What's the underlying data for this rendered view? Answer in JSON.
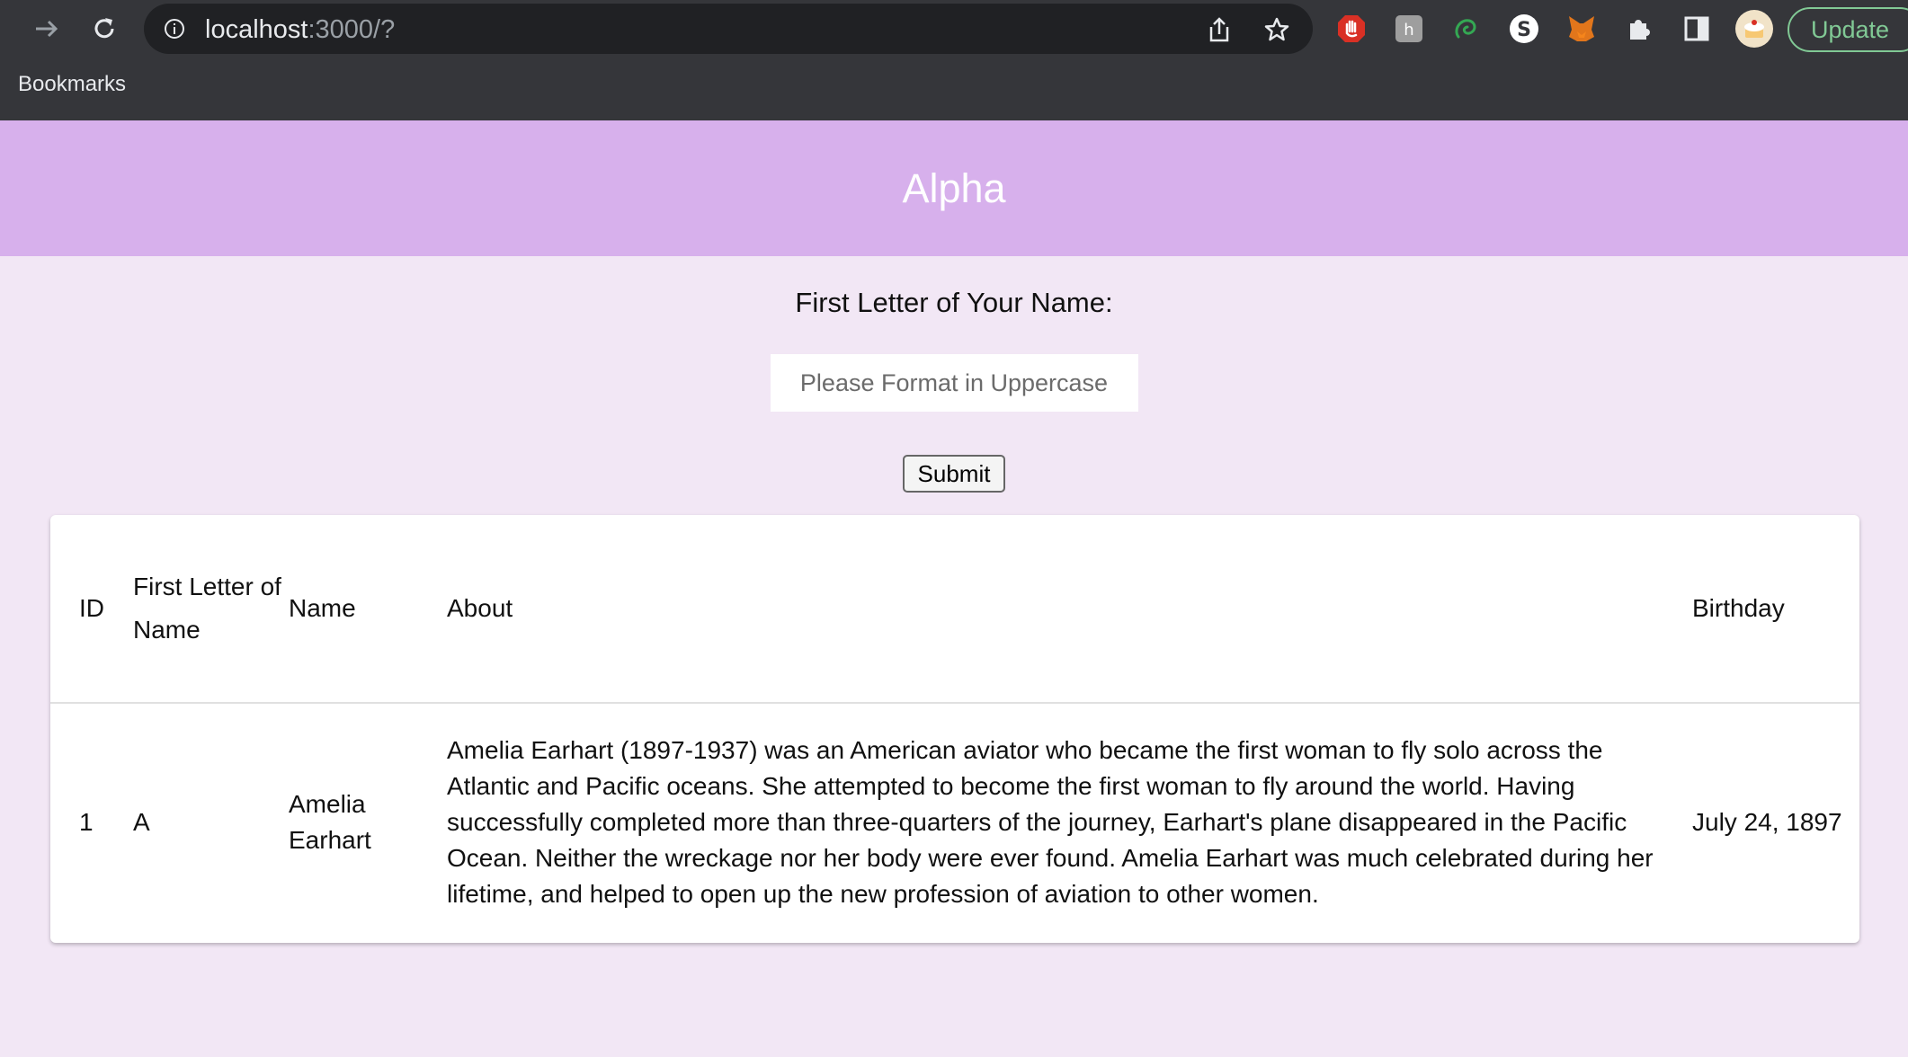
{
  "browser": {
    "url_host": "localhost",
    "url_path": ":3000/?",
    "update_label": "Update",
    "bookmarks_label": "Bookmarks"
  },
  "page": {
    "title": "Alpha",
    "form_label": "First Letter of Your Name:",
    "input_placeholder": "Please Format in Uppercase",
    "input_value": "",
    "submit_label": "Submit"
  },
  "table": {
    "headers": {
      "id": "ID",
      "letter": "First Letter of Name",
      "name": "Name",
      "about": "About",
      "birthday": "Birthday"
    },
    "rows": [
      {
        "id": "1",
        "letter": "A",
        "name": "Amelia Earhart",
        "about": "Amelia Earhart (1897-1937) was an American aviator who became the first woman to fly solo across the Atlantic and Pacific oceans. She attempted to become the first woman to fly around the world. Having successfully completed more than three-quarters of the journey, Earhart's plane disappeared in the Pacific Ocean. Neither the wreckage nor her body were ever found. Amelia Earhart was much celebrated during her lifetime, and helped to open up the new profession of aviation to other women.",
        "birthday": "July 24, 1897"
      }
    ]
  },
  "colors": {
    "header_bg": "#d7b0ec",
    "page_bg": "#f2e7f5",
    "chrome_bg": "#35363a"
  },
  "icons": [
    "back-icon",
    "forward-icon",
    "reload-icon",
    "info-icon",
    "share-icon",
    "star-icon",
    "adblock-icon",
    "extension-h-icon",
    "extension-swirl-icon",
    "extension-s-icon",
    "metamask-icon",
    "puzzle-icon",
    "sidepanel-icon",
    "profile-avatar"
  ]
}
